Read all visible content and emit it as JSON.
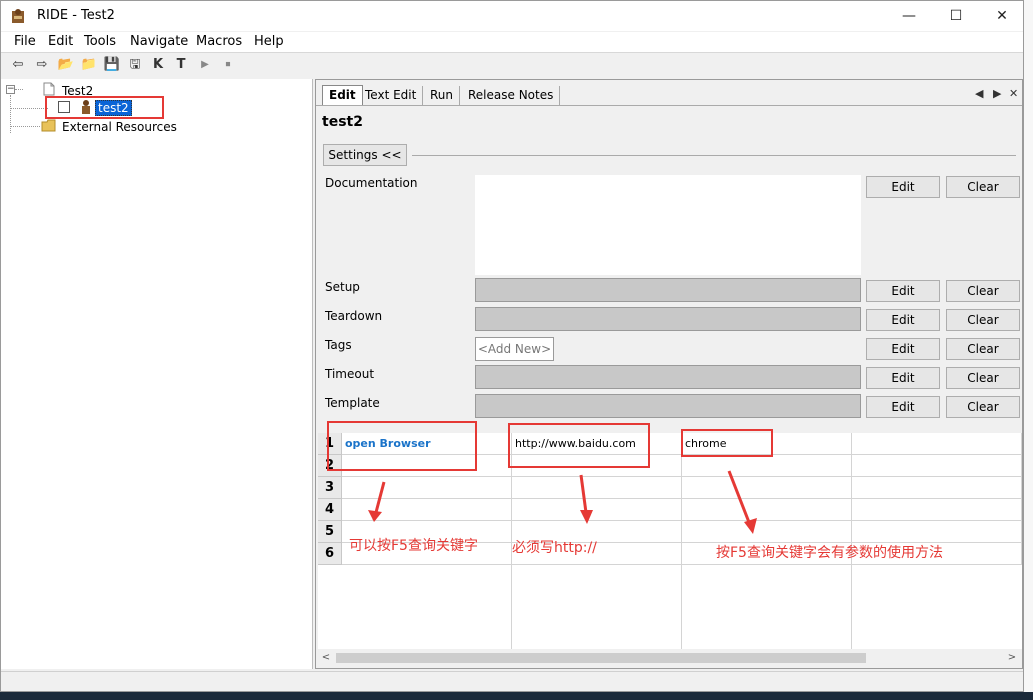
{
  "window": {
    "title": "RIDE - Test2",
    "minimize": "—",
    "maximize": "☐",
    "close": "✕"
  },
  "menu": [
    "File",
    "Edit",
    "Tools",
    "Navigate",
    "Macros",
    "Help"
  ],
  "toolbar": [
    "⇦",
    "⇨",
    "📂",
    "📁",
    "💾",
    "🖫",
    "K",
    "T",
    "▶",
    "⏹"
  ],
  "tree": {
    "root": "Test2",
    "test": "test2",
    "external": "External Resources"
  },
  "tabs": [
    {
      "label": "Edit"
    },
    {
      "label": "Text Edit"
    },
    {
      "label": "Run"
    },
    {
      "label": "Release Notes"
    }
  ],
  "tabnav": {
    "prev": "◀",
    "next": "▶",
    "close": "✕"
  },
  "editor": {
    "test_name": "test2",
    "settings_toggle": "Settings <<",
    "fields": {
      "documentation": "Documentation",
      "setup": "Setup",
      "teardown": "Teardown",
      "tags": "Tags",
      "timeout": "Timeout",
      "template": "Template"
    },
    "tags_placeholder": "<Add New>",
    "edit_label": "Edit",
    "clear_label": "Clear"
  },
  "grid": {
    "rows": [
      "1",
      "2",
      "3",
      "4",
      "5",
      "6"
    ],
    "row1": {
      "keyword": "open Browser",
      "arg1": "http://www.baidu.com",
      "arg2": "chrome"
    }
  },
  "annotations": {
    "note1": "可以按F5查询关键字",
    "note2": "必须写http://",
    "note3": "按F5查询关键字会有参数的使用方法",
    "color": "#e53935"
  },
  "scroll": {
    "left": "<",
    "right": ">"
  }
}
